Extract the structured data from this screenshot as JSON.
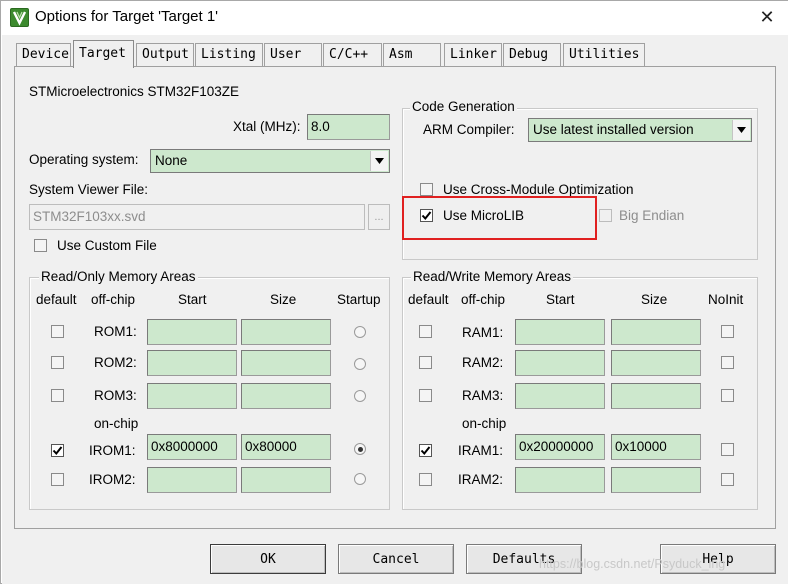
{
  "window": {
    "title": "Options for Target 'Target 1'",
    "close_glyph": "✕"
  },
  "icons": {
    "app": "keil-uvision-icon",
    "close": "close-icon",
    "dropdown": "chevron-down-icon",
    "check": "check-mark-icon"
  },
  "colors": {
    "field_bg": "#cde8cd",
    "highlight_border": "#e02020"
  },
  "tabs": [
    "Device",
    "Target",
    "Output",
    "Listing",
    "User",
    "C/C++",
    "Asm",
    "Linker",
    "Debug",
    "Utilities"
  ],
  "active_tab": "Target",
  "target": {
    "device_name": "STMicroelectronics STM32F103ZE",
    "xtal_label": "Xtal (MHz):",
    "xtal_value": "8.0",
    "os_label": "Operating system:",
    "os_value": "None",
    "svd_label": "System Viewer File:",
    "svd_value": "STM32F103xx.svd",
    "browse_label": "...",
    "use_custom_file": "Use Custom File"
  },
  "code_gen": {
    "title": "Code Generation",
    "compiler_label": "ARM Compiler:",
    "compiler_value": "Use latest installed version",
    "cross_module": "Use Cross-Module Optimization",
    "microlib": "Use MicroLIB",
    "big_endian": "Big Endian"
  },
  "ro": {
    "title": "Read/Only Memory Areas",
    "headers": [
      "default",
      "off-chip",
      "Start",
      "Size",
      "Startup"
    ],
    "onchip_label": "on-chip",
    "rows": [
      {
        "name": "ROM1:",
        "start": "",
        "size": "",
        "default": false,
        "startup": false
      },
      {
        "name": "ROM2:",
        "start": "",
        "size": "",
        "default": false,
        "startup": false
      },
      {
        "name": "ROM3:",
        "start": "",
        "size": "",
        "default": false,
        "startup": false
      },
      {
        "name": "IROM1:",
        "start": "0x8000000",
        "size": "0x80000",
        "default": true,
        "startup": true
      },
      {
        "name": "IROM2:",
        "start": "",
        "size": "",
        "default": false,
        "startup": false
      }
    ]
  },
  "rw": {
    "title": "Read/Write Memory Areas",
    "headers": [
      "default",
      "off-chip",
      "Start",
      "Size",
      "NoInit"
    ],
    "onchip_label": "on-chip",
    "rows": [
      {
        "name": "RAM1:",
        "start": "",
        "size": "",
        "default": false,
        "noinit": false
      },
      {
        "name": "RAM2:",
        "start": "",
        "size": "",
        "default": false,
        "noinit": false
      },
      {
        "name": "RAM3:",
        "start": "",
        "size": "",
        "default": false,
        "noinit": false
      },
      {
        "name": "IRAM1:",
        "start": "0x20000000",
        "size": "0x10000",
        "default": true,
        "noinit": false
      },
      {
        "name": "IRAM2:",
        "start": "",
        "size": "",
        "default": false,
        "noinit": false
      }
    ]
  },
  "buttons": {
    "ok": "OK",
    "cancel": "Cancel",
    "defaults": "Defaults",
    "help": "Help"
  },
  "watermark": "https://blog.csdn.net/Psyduck_ing"
}
